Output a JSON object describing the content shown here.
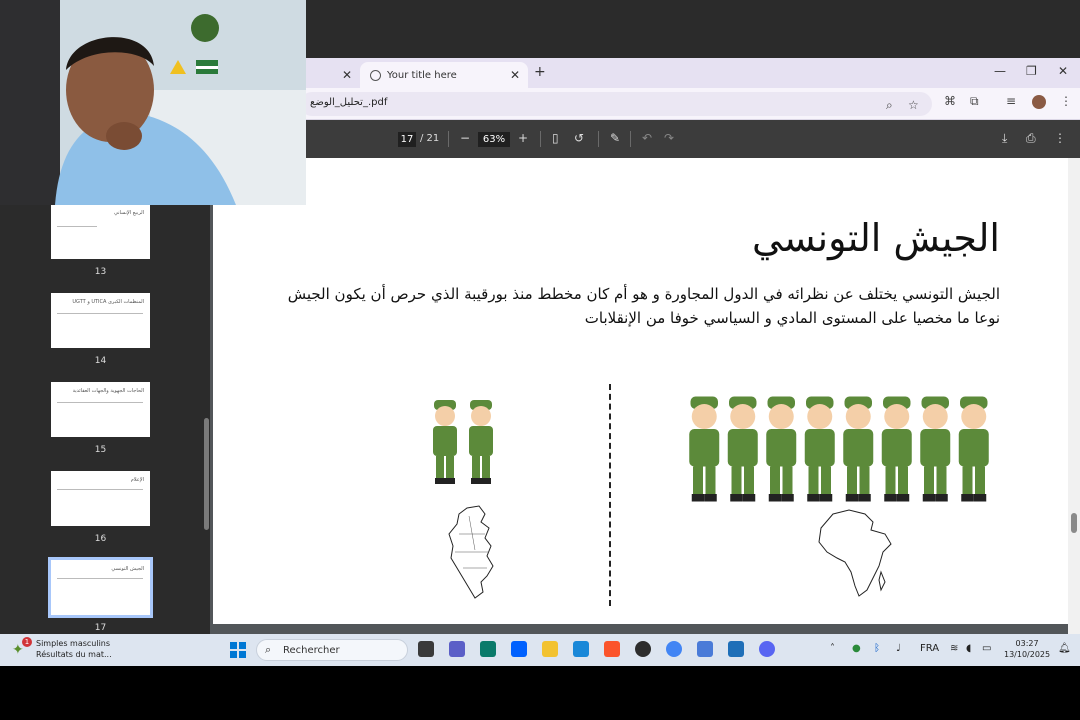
{
  "browser": {
    "tab_active_title": "Your title here",
    "new_tab": "+",
    "url": "تحليل_الوضع_.pdf",
    "window_controls": [
      "—",
      "❐",
      "✕"
    ]
  },
  "pdf_toolbar": {
    "current_page": "17",
    "total_pages": "/ 21",
    "zoom": "63%"
  },
  "sidebar": {
    "thumbnails": [
      {
        "label": "13",
        "title": "الربيع الإنساني"
      },
      {
        "label": "14",
        "title": "UGTT و UTICA المنظمات الكبرى"
      },
      {
        "label": "15",
        "title": "الحاجات الجهوية والجهات العقائدية"
      },
      {
        "label": "16",
        "title": "الإعلام"
      },
      {
        "label": "17",
        "title": "الجيش التونسي"
      }
    ]
  },
  "slide": {
    "title": "الجيش التونسي",
    "body": "الجيش التونسي يختلف عن نظرائه في الدول المجاورة و هو أم كان مخطط منذ بورقيبة الذي حرص أن يكون الجيش نوعا ما مخصيا على المستوى المادي و السياسي خوفا من الإنقلابات",
    "left_soldiers": 2,
    "right_soldiers": 8
  },
  "taskbar": {
    "news_title": "Simples masculins",
    "news_sub": "Résultats du mat...",
    "news_badge": "1",
    "search_placeholder": "Rechercher",
    "language": "FRA",
    "time": "03:27",
    "date": "13/10/2025"
  },
  "colors": {
    "tabstrip": "#e6e1f2",
    "pdf_toolbar": "#3c3c3c",
    "viewer_bg": "#525659",
    "taskbar": "#dde5f0",
    "soldier_uniform": "#5c8a3a"
  }
}
